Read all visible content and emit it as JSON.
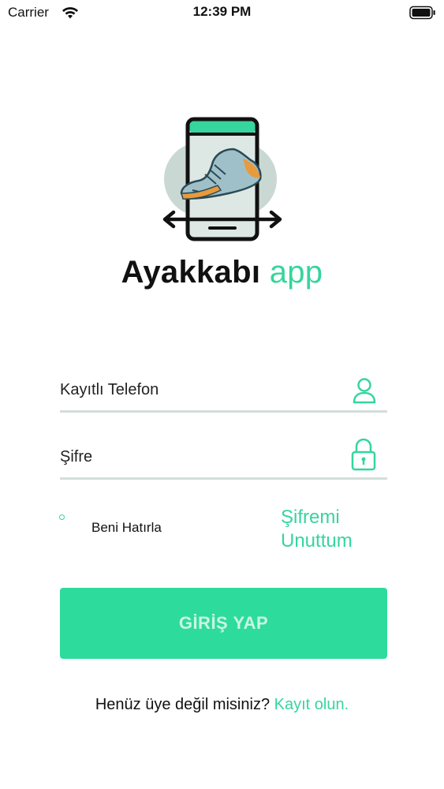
{
  "status_bar": {
    "carrier": "Carrier",
    "time": "12:39 PM"
  },
  "app": {
    "title_main": "Ayakkabı",
    "title_accent": "app"
  },
  "form": {
    "phone_placeholder": "Kayıtlı Telefon",
    "password_placeholder": "Şifre",
    "remember_label": "Beni Hatırla",
    "forgot_label": "Şifremi Unuttum",
    "login_label": "GİRİŞ YAP"
  },
  "signup": {
    "prompt": "Henüz üye değil misiniz?",
    "link": "Kayıt olun."
  },
  "icons": {
    "wifi": "wifi-icon",
    "battery": "battery-icon",
    "user": "user-icon",
    "lock": "lock-icon",
    "logo": "shoe-phone-logo-icon"
  },
  "colors": {
    "accent": "#35d59d",
    "button_bg": "#2ddb9c",
    "button_text": "#c9f5e4",
    "underline": "#d2dfdb"
  }
}
